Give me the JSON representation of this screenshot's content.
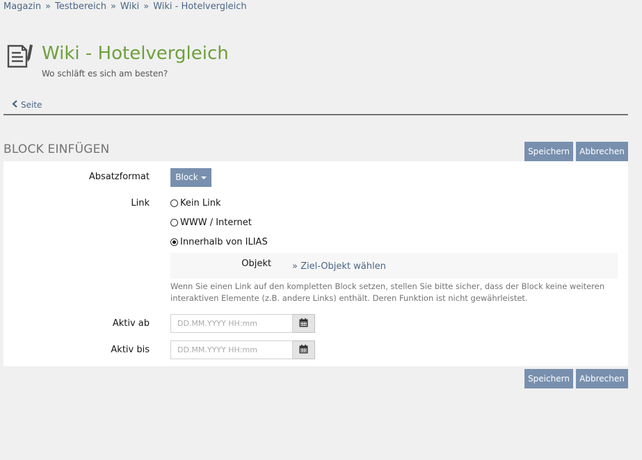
{
  "breadcrumb": {
    "items": [
      "Magazin",
      "Testbereich",
      "Wiki",
      "Wiki - Hotelvergleich"
    ],
    "separator": "»"
  },
  "header": {
    "title": "Wiki - Hotelvergleich",
    "subtitle": "Wo schläft es sich am besten?",
    "icon": "wiki-document-icon"
  },
  "tabs": {
    "back_label": "Seite"
  },
  "section": {
    "title": "BLOCK EINFÜGEN"
  },
  "actions": {
    "save_label": "Speichern",
    "cancel_label": "Abbrechen"
  },
  "form": {
    "absatzformat_label": "Absatzformat",
    "absatzformat_value": "Block",
    "link_label": "Link",
    "link_options": [
      "Kein Link",
      "WWW / Internet",
      "Innerhalb von ILIAS"
    ],
    "link_selected": "Innerhalb von ILIAS",
    "objekt_label": "Objekt",
    "objekt_link": "» Ziel-Objekt wählen",
    "info": "Wenn Sie einen Link auf den kompletten Block setzen, stellen Sie bitte sicher, dass der Block keine weiteren interaktiven Elemente (z.B. andere Links) enthält. Deren Funktion ist nicht gewährleistet.",
    "aktiv_ab_label": "Aktiv ab",
    "aktiv_bis_label": "Aktiv bis",
    "date_placeholder": "DD.MM.YYYY HH:mm"
  },
  "colors": {
    "accent_button": "#7890ae",
    "title_green": "#6ea03c",
    "link_blue": "#4c6586"
  }
}
